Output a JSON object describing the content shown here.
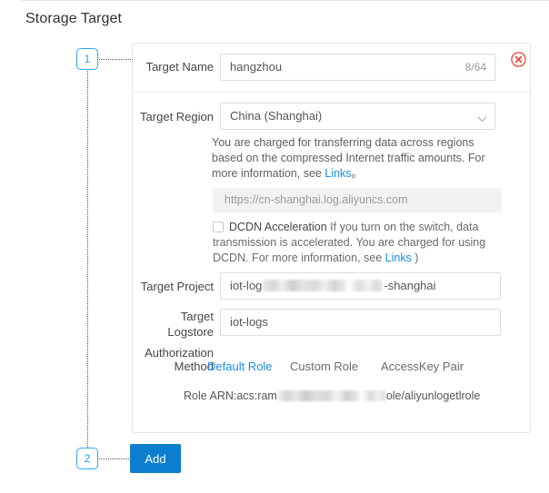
{
  "page": {
    "title": "Storage Target"
  },
  "steps": [
    {
      "number": "1"
    },
    {
      "number": "2"
    }
  ],
  "form": {
    "target_name": {
      "label": "Target Name",
      "value": "hangzhou",
      "counter": "8/64",
      "delete_icon": "delete-circle-icon"
    },
    "target_region": {
      "label": "Target Region",
      "value": "China (Shanghai)",
      "chevron_icon": "chevron-down-icon",
      "help_text_before": "You are charged for transferring data across regions based on the compressed Internet traffic amounts. For more information, see ",
      "help_link": "Links",
      "help_text_after": "。"
    },
    "endpoint": {
      "value": "https://cn-shanghai.log.aliyuncs.com"
    },
    "dcdn": {
      "checkbox_label": "DCDN Acceleration",
      "checked": false,
      "description_before": " If you turn on the switch, data transmission is accelerated. You are charged for using DCDN. For more information, see ",
      "link": "Links",
      "description_after": " )"
    },
    "target_project": {
      "label": "Target Project",
      "value_prefix": "iot-log",
      "value_suffix": "-shanghai",
      "redacted": true
    },
    "target_logstore": {
      "label": "Target Logstore",
      "value": "iot-logs"
    },
    "authorization": {
      "label": "Authorization Method",
      "tabs": [
        {
          "label": "Default Role",
          "active": true
        },
        {
          "label": "Custom Role",
          "active": false
        },
        {
          "label": "AccessKey Pair",
          "active": false
        }
      ],
      "role_arn_prefix": "Role ARN:acs:ram",
      "role_arn_suffix": "ole/aliyunlogetlrole",
      "redacted": true
    }
  },
  "actions": {
    "add_label": "Add"
  },
  "colors": {
    "accent": "#0b7ed0",
    "link": "#1b8ae8",
    "step": "#2aaaf3",
    "danger": "#f5453a"
  }
}
